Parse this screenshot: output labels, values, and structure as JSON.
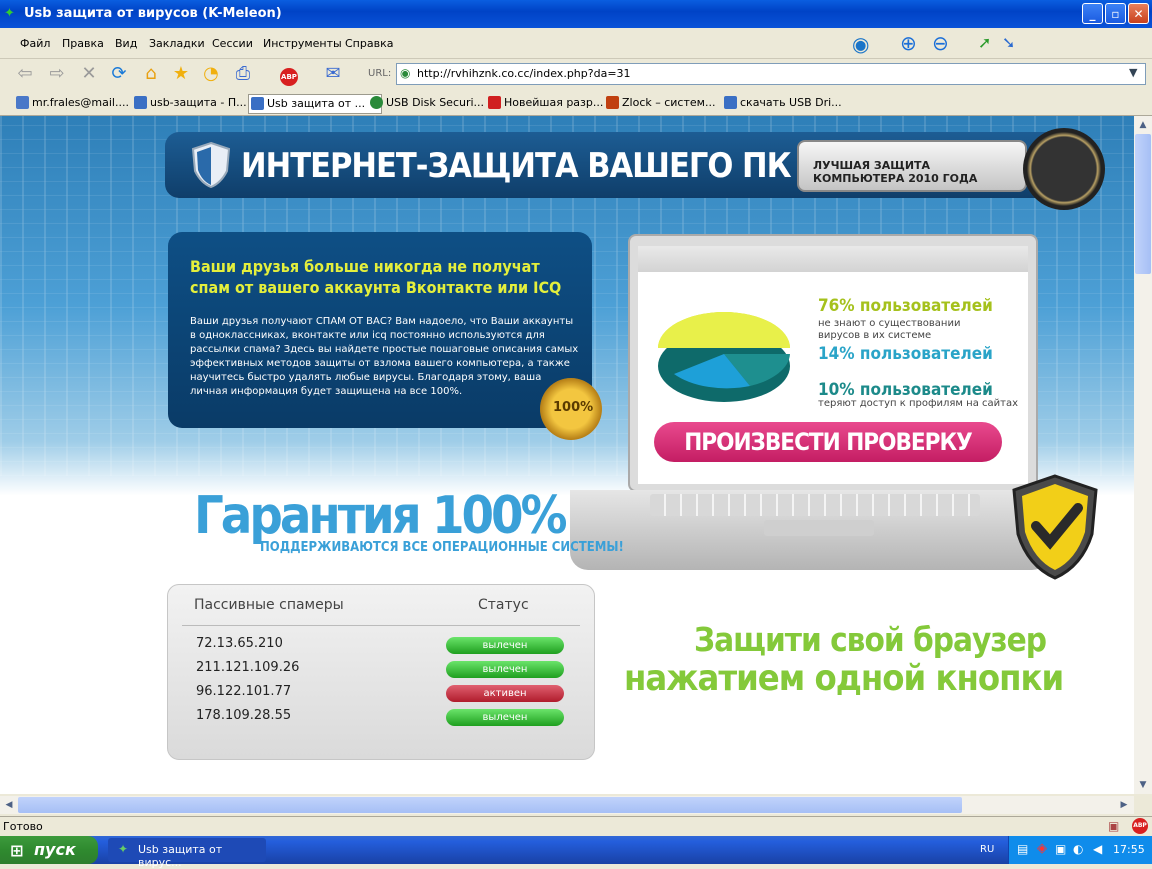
{
  "window": {
    "title": "Usb защита от вирусов (K-Meleon)",
    "minimize": "_",
    "maximize": "▫",
    "close": "✕"
  },
  "menu": [
    "Файл",
    "Правка",
    "Вид",
    "Закладки",
    "Сессии",
    "Инструменты",
    "Справка"
  ],
  "toolbar": {
    "url_label": "URL:",
    "url": "http://rvhihznk.co.cc/index.php?da=31"
  },
  "bookmarks": [
    {
      "label": "mr.frales@mail....",
      "color": "#4a78c8"
    },
    {
      "label": "usb-защита - П...",
      "color": "#3a6fc4"
    },
    {
      "label": "Usb защита от ...",
      "color": "#3a6fc4"
    },
    {
      "label": "USB Disk Securi...",
      "color": "#2a8a3a"
    },
    {
      "label": "Новейшая разр...",
      "color": "#d02020"
    },
    {
      "label": "Zlock – систем...",
      "color": "#c04010"
    },
    {
      "label": "скачать USB Dri...",
      "color": "#3a6fc4"
    }
  ],
  "page": {
    "header": "ИНТЕРНЕТ-ЗАЩИТА ВАШЕГО ПК",
    "award": "ЛУЧШАЯ ЗАЩИТА КОМПЬЮТЕРА 2010 ГОДА",
    "spam_title": "Ваши друзья больше никогда не получат спам от вашего аккаунта Вконтакте или ICQ",
    "spam_body": "Ваши друзья получают СПАМ ОТ ВАС? Вам надоело, что Ваши аккаунты в одноклассниках, вконтакте или icq постоянно используются для рассылки спама? Здесь вы найдете простые пошаговые описания самых эффективных методов защиты от взлома вашего компьютера, а также научитесь быстро удалять любые вирусы. Благодаря этому, ваша личная информация будет защищена на все 100%.",
    "seal_text": "100%",
    "stats": [
      {
        "big": "76% пользователей",
        "small": "не знают о существовании вирусов в их системе",
        "color": "#a5c11c"
      },
      {
        "big": "14% пользователей",
        "small": "",
        "color": "#2aa4c8"
      },
      {
        "big": "10% пользователей",
        "small": "теряют доступ к профилям на сайтах",
        "color": "#1c8a8a"
      }
    ],
    "check_button": "ПРОИЗВЕСТИ ПРОВЕРКУ",
    "guarantee": "Гарантия 100%",
    "guarantee_sub": "ПОДДЕРЖИВАЮТСЯ ВСЕ ОПЕРАЦИОННЫЕ СИСТЕМЫ!",
    "table": {
      "col1": "Пассивные спамеры",
      "col2": "Статус",
      "rows": [
        {
          "ip": "72.13.65.210",
          "status": "вылечен",
          "state": "off"
        },
        {
          "ip": "211.121.109.26",
          "status": "вылечен",
          "state": "off"
        },
        {
          "ip": "96.122.101.77",
          "status": "активен",
          "state": "on"
        },
        {
          "ip": "178.109.28.55",
          "status": "вылечен",
          "state": "off"
        }
      ]
    },
    "protect_line1": "Защити свой браузер",
    "protect_line2": "нажатием одной кнопки"
  },
  "statusbar": {
    "text": "Готово"
  },
  "taskbar": {
    "start": "пуск",
    "task": "Usb защита от вирус...",
    "lang": "RU",
    "clock": "17:55"
  }
}
